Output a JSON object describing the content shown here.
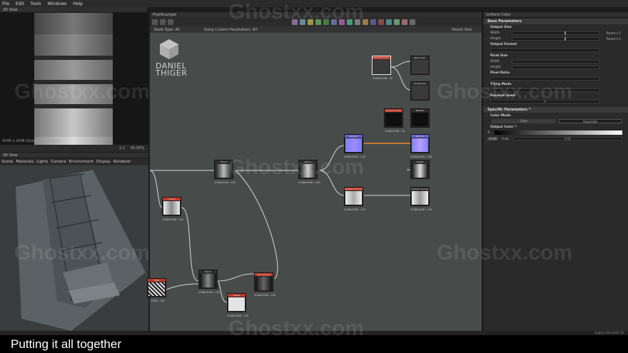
{
  "menu": [
    "File",
    "Edit",
    "Tools",
    "Windows",
    "Help"
  ],
  "view2d": {
    "title": "2D View",
    "footer": "2048 x 2048 (Grayscale, 16bpc)",
    "ratio": "1:1",
    "zoom": "45.50%"
  },
  "view3d": {
    "title": "3D View",
    "tabs": [
      "Scene",
      "Materials",
      "Lights",
      "Camera",
      "Environment",
      "Display",
      "Renderer"
    ]
  },
  "graph": {
    "title": "PixelExample",
    "node_type_label": "Node Type: All",
    "params_label": "Using Custom Parameters: All",
    "parent_size": "Parent Size",
    "logo": "DANIEL\nTHIGER",
    "nodes": [
      {
        "id": "n1",
        "header": "Uniform Color",
        "caption": "2048x2048 - L8"
      },
      {
        "id": "n2",
        "header": "Base Color",
        "caption": ""
      },
      {
        "id": "n3",
        "header": "Roughness",
        "caption": ""
      },
      {
        "id": "n4",
        "header": "Uniform Color",
        "caption": "2048x2048 - L8"
      },
      {
        "id": "n5",
        "header": "Metallic",
        "caption": ""
      },
      {
        "id": "n6",
        "header": "Normal",
        "caption": "2048x2048 - C16"
      },
      {
        "id": "n7",
        "header": "Normal",
        "caption": "2048x2048 - C16"
      },
      {
        "id": "n8",
        "header": "Blend",
        "caption": "2048x2048 - L16"
      },
      {
        "id": "n9",
        "header": "Blend",
        "caption": "2048x2048 - L16"
      },
      {
        "id": "n10",
        "header": "Height",
        "caption": "2048x2048 - L16"
      },
      {
        "id": "n11",
        "header": "Ambient Occlusion",
        "caption": "2048x2048 - L16"
      },
      {
        "id": "n12",
        "header": "Ambient Occlusion",
        "caption": "2048x2048 - L16"
      },
      {
        "id": "n13",
        "header": "Output",
        "caption": "2048x2048 - L16"
      },
      {
        "id": "n14",
        "header": "Blend",
        "caption": "2048x2048 - L16"
      },
      {
        "id": "n15",
        "header": "Tile Sampler",
        "caption": "2048x2048 - L16"
      },
      {
        "id": "n16",
        "header": "Shape",
        "caption": "2048x2048 - L16"
      },
      {
        "id": "n17",
        "header": "Directional Warp",
        "caption": "2048x2048 - L16"
      },
      {
        "id": "n18",
        "header": "Cells",
        "caption": "2048 - L16"
      }
    ]
  },
  "props": {
    "title": "Uniform Color",
    "base_params": "Base Parameters",
    "output_size": "Output Size",
    "width": "Width",
    "height": "Height",
    "parent_x1": "Parent x 1",
    "output_format": "Output Format",
    "pixel_size": "Pixel Size",
    "pixel_ratio": "Pixel Ratio",
    "tiling_mode": "Tiling Mode",
    "random_seed": "Random Seed",
    "random_seed_val": "0",
    "specific": "Specific Parameters *",
    "color_mode": "Color Mode",
    "color": "Color",
    "grayscale": "Grayscale",
    "output_color": "Output Color *",
    "float_label": "Float",
    "color_value": "0.52",
    "tweak": "sRGB"
  },
  "status": "Engine: Direct3D 10",
  "caption": "Putting it all together",
  "watermark": "Ghostxx.com"
}
